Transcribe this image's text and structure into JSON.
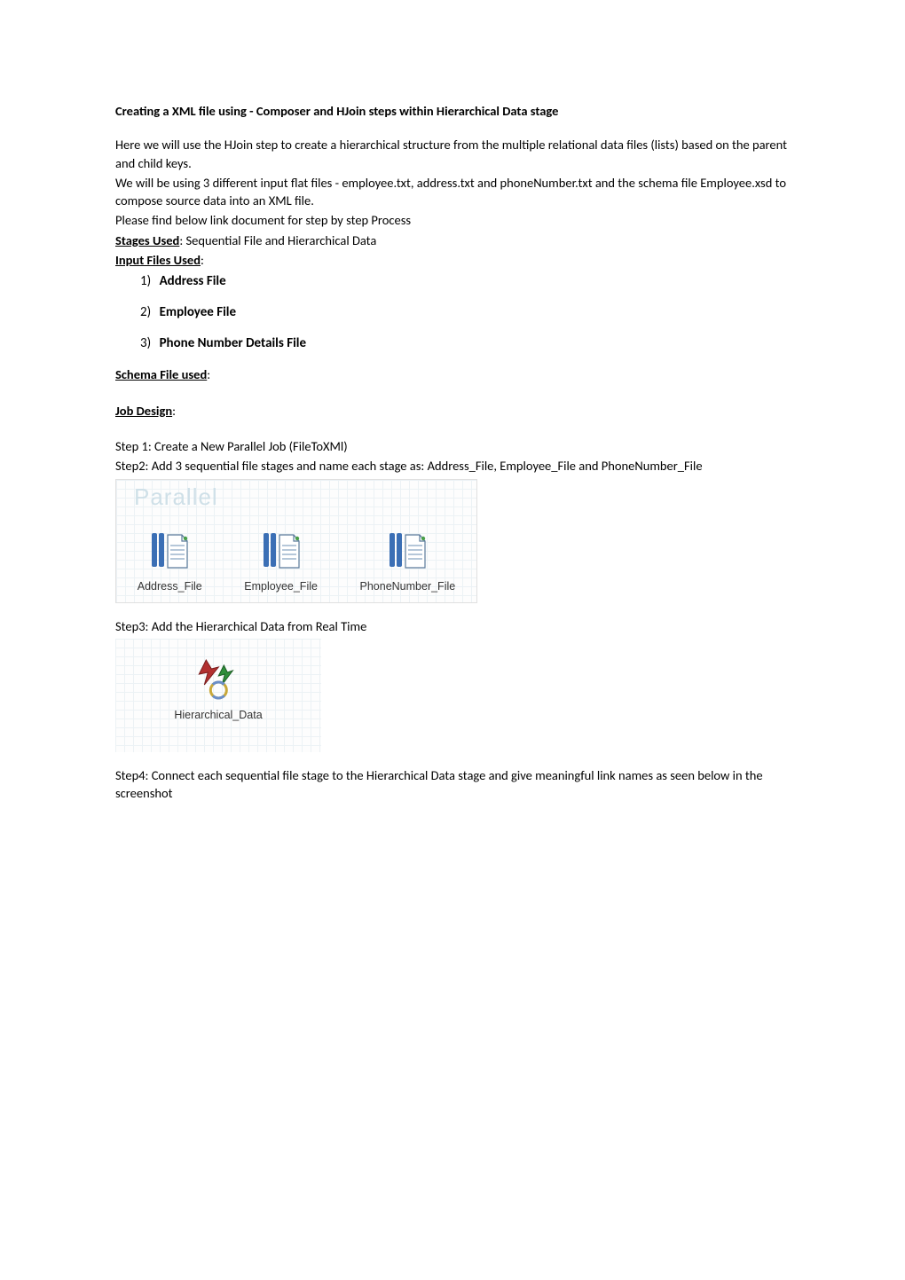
{
  "title": "Creating a XML file using - Composer and HJoin steps within Hierarchical Data stage",
  "intro": {
    "p1": "Here we will use the HJoin step to create a hierarchical structure from the multiple relational data files (lists) based on the parent and child keys.",
    "p2": "We will be using 3 different input flat files - employee.txt, address.txt and phoneNumber.txt and the schema file Employee.xsd to compose source data into an XML file.",
    "p3": "Please find below link document for step by step Process"
  },
  "stages": {
    "label": "Stages Used",
    "value": ": Sequential File and Hierarchical Data"
  },
  "inputFiles": {
    "label": "Input Files Used",
    "colon": ":",
    "items": [
      {
        "num": "1)",
        "label": "Address File"
      },
      {
        "num": "2)",
        "label": "Employee File"
      },
      {
        "num": "3)",
        "label": "Phone Number Details File"
      }
    ]
  },
  "schemaFile": {
    "heading": "Schema File used",
    "colon": ":"
  },
  "jobDesign": {
    "heading": "Job Design",
    "colon": ":"
  },
  "steps": {
    "s1": " Step 1: Create a New Parallel Job (FileToXMl)",
    "s2": " Step2: Add 3 sequential file stages and name each stage as: Address_File, Employee_File and PhoneNumber_File",
    "s3": "Step3: Add the Hierarchical Data from Real Time",
    "s4": "Step4: Connect each sequential file stage to the Hierarchical Data stage and give meaningful link names as seen below in the screenshot"
  },
  "fig1": {
    "watermark": "Parallel",
    "stages": [
      {
        "label": "Address_File"
      },
      {
        "label": "Employee_File"
      },
      {
        "label": "PhoneNumber_File"
      }
    ]
  },
  "fig2": {
    "label": "Hierarchical_Data"
  }
}
